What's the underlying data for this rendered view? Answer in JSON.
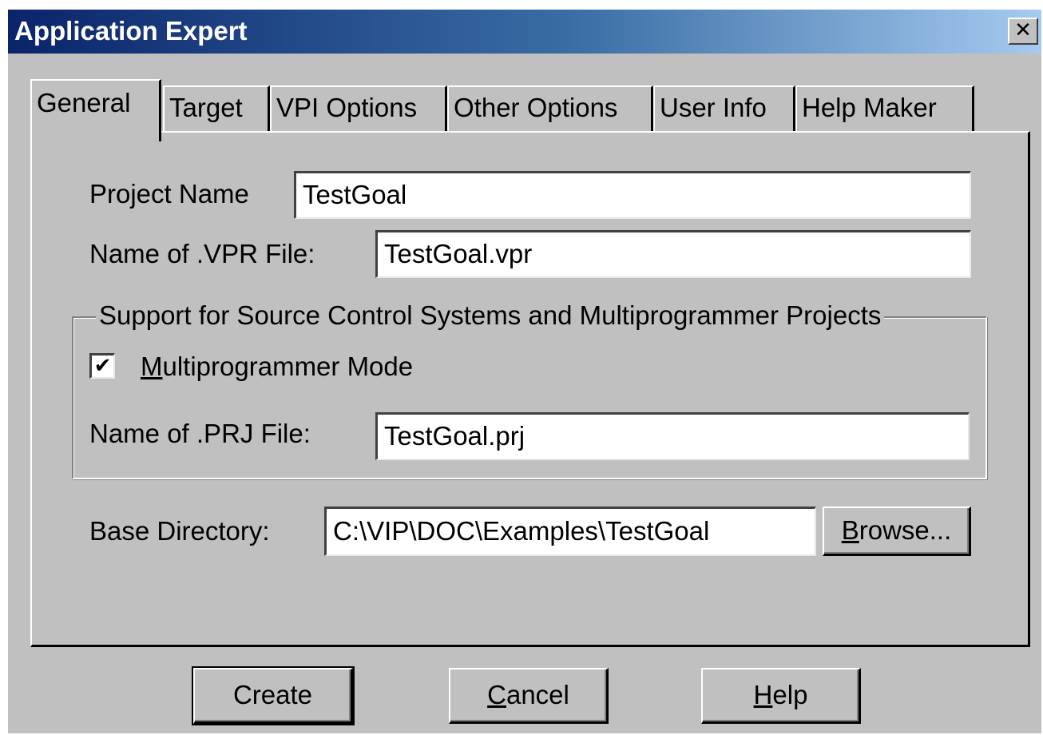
{
  "window": {
    "title": "Application Expert",
    "close_glyph": "✕"
  },
  "tabs": [
    {
      "label": "General",
      "active": true
    },
    {
      "label": "Target",
      "active": false
    },
    {
      "label": "VPI Options",
      "active": false
    },
    {
      "label": "Other Options",
      "active": false
    },
    {
      "label": "User Info",
      "active": false
    },
    {
      "label": "Help Maker",
      "active": false
    }
  ],
  "general": {
    "project_name_label": "Project Name",
    "project_name_value": "TestGoal",
    "vpr_file_label": "Name of .VPR File:",
    "vpr_file_value": "TestGoal.vpr",
    "source_control_group_label": "Support for Source Control Systems and Multiprogrammer Projects",
    "multiprogrammer_mode": {
      "label_accel": "M",
      "label_rest": "ultiprogrammer Mode",
      "checked": true,
      "check_glyph": "✔"
    },
    "prj_file_label": "Name of .PRJ File:",
    "prj_file_value": "TestGoal.prj",
    "base_directory_label": "Base Directory:",
    "base_directory_value": "C:\\VIP\\DOC\\Examples\\TestGoal",
    "browse_button": {
      "accel": "B",
      "rest": "rowse..."
    }
  },
  "buttons": {
    "create": "Create",
    "cancel": {
      "accel": "C",
      "rest": "ancel"
    },
    "help": {
      "accel": "H",
      "rest": "elp"
    }
  },
  "colors": {
    "titlebar_start": "#0a246a",
    "titlebar_end": "#a6caf0",
    "dialog_face": "#c0c0c0"
  }
}
